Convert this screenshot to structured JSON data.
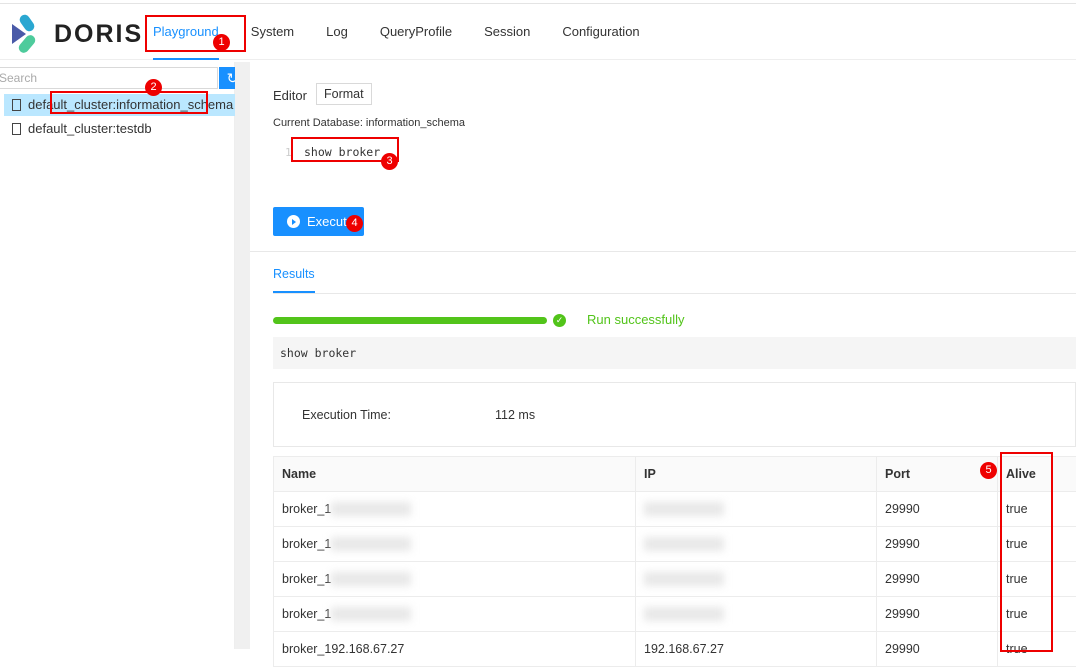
{
  "app": {
    "logo_text": "DORIS"
  },
  "nav": [
    "Playground",
    "System",
    "Log",
    "QueryProfile",
    "Session",
    "Configuration"
  ],
  "sidebar": {
    "search_placeholder": "Search",
    "items": [
      "default_cluster:information_schema",
      "default_cluster:testdb"
    ]
  },
  "editor": {
    "label": "Editor",
    "format_label": "Format",
    "current_db": "Current Database: information_schema",
    "line_number": "1",
    "code": "show broker",
    "execute_label": "Execute"
  },
  "results": {
    "tab": "Results",
    "status": "Run successfully",
    "sql": "show broker",
    "exec_time_label": "Execution Time:",
    "exec_time_value": "112 ms",
    "columns": [
      "Name",
      "IP",
      "Port",
      "Alive"
    ],
    "rows": [
      [
        "broker_1",
        "",
        "29990",
        "true"
      ],
      [
        "broker_1",
        "",
        "29990",
        "true"
      ],
      [
        "broker_1",
        "",
        "29990",
        "true"
      ],
      [
        "broker_1",
        "",
        "29990",
        "true"
      ],
      [
        "broker_192.168.67.27",
        "192.168.67.27",
        "29990",
        "true"
      ]
    ]
  },
  "annotations": [
    "1",
    "2",
    "3",
    "4",
    "5"
  ],
  "colors": {
    "accent": "#1890ff",
    "success": "#52c41a",
    "annotation": "#e00000"
  }
}
